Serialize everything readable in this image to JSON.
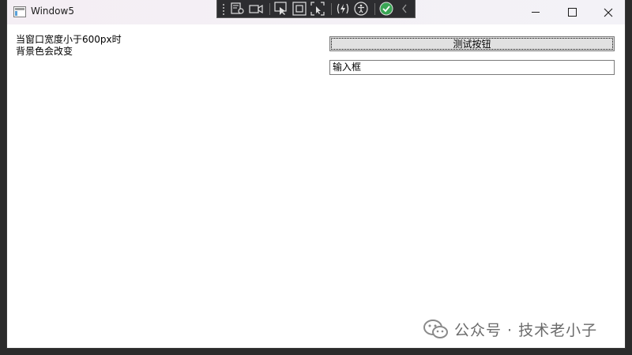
{
  "window": {
    "title": "Window5"
  },
  "debug_toolbar": {
    "icons": [
      "live-visual-tree-icon",
      "record-icon",
      "select-element-icon",
      "display-layout-adorners-icon",
      "track-focus-icon",
      "hot-reload-icon",
      "accessibility-icon",
      "check-icon",
      "collapse-chevron-icon"
    ]
  },
  "caption": {
    "minimize": "minimize",
    "maximize": "maximize",
    "close": "close"
  },
  "content": {
    "hint_line1": "当窗口宽度小于600px时",
    "hint_line2": "背景色会改变",
    "test_button_label": "测试按钮",
    "input_value": "输入框"
  },
  "watermark": {
    "text": "公众号 · 技术老小子"
  },
  "colors": {
    "titlebar": "#f4eef4",
    "toolbar": "#2d2d30",
    "button_bg": "#e1e1e1",
    "border": "#7a7a7a",
    "check_green": "#3aa655"
  }
}
